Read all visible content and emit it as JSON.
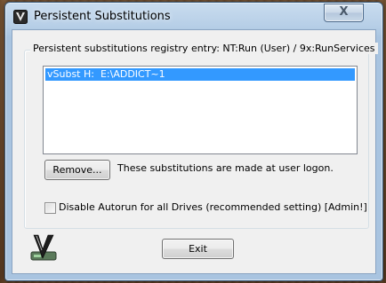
{
  "window": {
    "title": "Persistent Substitutions",
    "close_glyph": "X"
  },
  "group": {
    "label": "Persistent substitutions registry entry: NT:Run (User) / 9x:RunServices"
  },
  "list": {
    "items": [
      {
        "text": "vSubst H:  E:\\ADDICT~1",
        "selected": true
      }
    ]
  },
  "actions": {
    "remove_label": "Remove...",
    "note": "These substitutions are made at user logon.",
    "exit_label": "Exit"
  },
  "options": {
    "disable_autorun_label": "Disable Autorun for all Drives (recommended setting)   [Admin!]",
    "disable_autorun_checked": false
  },
  "icons": {
    "app": "vsubst-app-icon",
    "badge": "vsubst-logo-icon",
    "close": "close-icon"
  },
  "colors": {
    "selection": "#3399ff",
    "client_bg": "#f0f0f0"
  }
}
